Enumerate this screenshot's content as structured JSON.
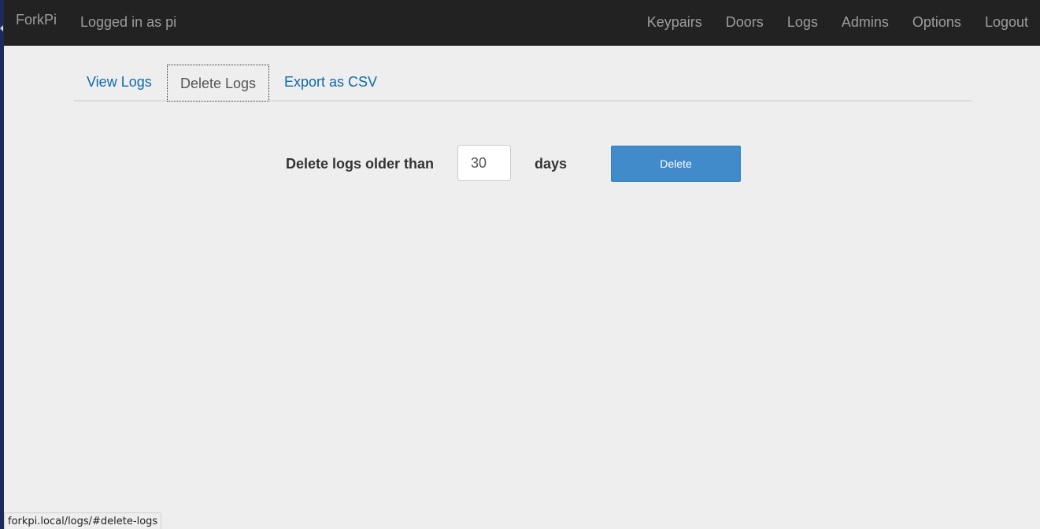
{
  "navbar": {
    "brand": "ForkPi",
    "logged_in_text": "Logged in as pi",
    "links": [
      "Keypairs",
      "Doors",
      "Logs",
      "Admins",
      "Options",
      "Logout"
    ]
  },
  "tabs": [
    {
      "label": "View Logs",
      "active": false
    },
    {
      "label": "Delete Logs",
      "active": true
    },
    {
      "label": "Export as CSV",
      "active": false
    }
  ],
  "delete_form": {
    "label": "Delete logs older than",
    "days_value": "30",
    "unit_label": "days",
    "button_label": "Delete"
  },
  "status_url": "forkpi.local/logs/#delete-logs",
  "colors": {
    "navbar_bg": "#222222",
    "navbar_text": "#9d9d9d",
    "link": "#0e6aa8",
    "button_primary": "#428bca",
    "page_bg": "#eeeeee"
  }
}
